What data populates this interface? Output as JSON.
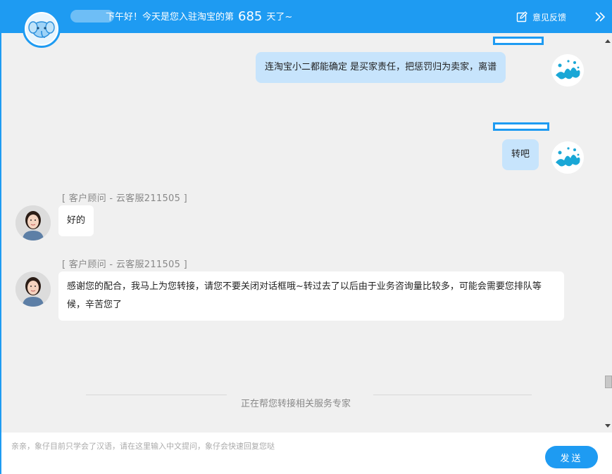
{
  "header": {
    "greeting": "下午好！今天是您入驻淘宝的第",
    "days": "685",
    "suffix": "天了~",
    "feedback_label": "意见反馈"
  },
  "messages": [
    {
      "side": "right",
      "text": "连淘宝小二都能确定 是买家责任，把惩罚归为卖家，离谱"
    },
    {
      "side": "right",
      "text": "转吧"
    },
    {
      "side": "left",
      "agent": "[ 客户顾问 - 云客服211505 ]",
      "text": "好的"
    },
    {
      "side": "left",
      "agent": "[ 客户顾问 - 云客服211505 ]",
      "text": "感谢您的配合，我马上为您转接，请您不要关闭对话框哦~转过去了以后由于业务咨询量比较多，可能会需要您排队等候，辛苦您了"
    }
  ],
  "transfer_status": "正在帮您转接相关服务专家",
  "input": {
    "placeholder": "亲亲，象仔目前只学会了汉语，请在这里输入中文提问，象仔会快速回复您哒",
    "value": ""
  },
  "send_label": "发送",
  "colors": {
    "brand": "#1e9bf2",
    "user_bubble": "#c7e4fc",
    "background": "#f0f0f0"
  }
}
